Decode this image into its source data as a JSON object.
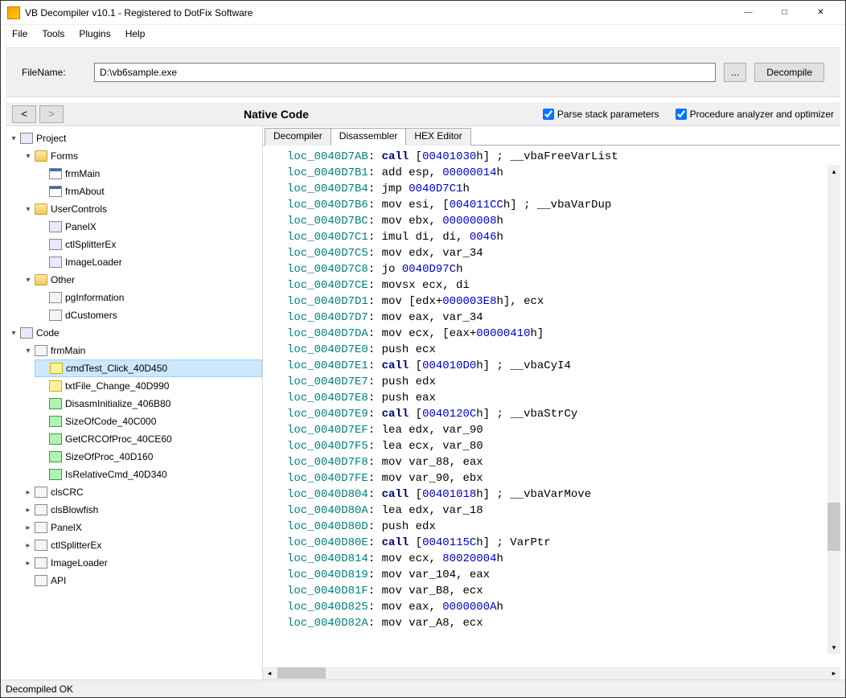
{
  "window": {
    "title": "VB Decompiler v10.1 - Registered to DotFix Software"
  },
  "menu": {
    "file": "File",
    "tools": "Tools",
    "plugins": "Plugins",
    "help": "Help"
  },
  "filebar": {
    "label": "FileName:",
    "value": "D:\\vb6sample.exe",
    "browse": "...",
    "decompile": "Decompile"
  },
  "navrow": {
    "back": "<",
    "fwd": ">",
    "native": "Native Code",
    "chk_parse": "Parse stack parameters",
    "chk_opt": "Procedure analyzer and optimizer"
  },
  "tree": {
    "project": "Project",
    "forms": "Forms",
    "frmMain": "frmMain",
    "frmAbout": "frmAbout",
    "usercontrols": "UserControls",
    "panelx": "PanelX",
    "ctlsplitter": "ctlSplitterEx",
    "imageloader": "ImageLoader",
    "other": "Other",
    "pginfo": "pgInformation",
    "dcustomers": "dCustomers",
    "code": "Code",
    "code_frmMain": "frmMain",
    "cmdtest": "cmdTest_Click_40D450",
    "txtfile": "txtFile_Change_40D990",
    "disasminit": "DisasmInitialize_406B80",
    "sizeofcode": "SizeOfCode_40C000",
    "getcrc": "GetCRCOfProc_40CE60",
    "sizeofproc": "SizeOfProc_40D160",
    "isrelative": "IsRelativeCmd_40D340",
    "clscrc": "clsCRC",
    "clsblowfish": "clsBlowfish",
    "panelx2": "PanelX",
    "ctlsplitter2": "ctlSplitterEx",
    "imageloader2": "ImageLoader",
    "api": "API"
  },
  "tabs": {
    "decompiler": "Decompiler",
    "disassembler": "Disassembler",
    "hex": "HEX Editor"
  },
  "code_lines": [
    {
      "loc": "loc_0040D7AB",
      "tokens": [
        {
          "t": "kw",
          "v": "call"
        },
        {
          "t": "sp",
          "v": " ["
        },
        {
          "t": "addr",
          "v": "00401030"
        },
        {
          "t": "op",
          "v": "h] ; __vbaFreeVarList"
        }
      ]
    },
    {
      "loc": "loc_0040D7B1",
      "tokens": [
        {
          "t": "op",
          "v": "add esp, "
        },
        {
          "t": "num",
          "v": "00000014"
        },
        {
          "t": "op",
          "v": "h"
        }
      ]
    },
    {
      "loc": "loc_0040D7B4",
      "tokens": [
        {
          "t": "op",
          "v": "jmp "
        },
        {
          "t": "addr",
          "v": "0040D7C1"
        },
        {
          "t": "op",
          "v": "h"
        }
      ]
    },
    {
      "loc": "loc_0040D7B6",
      "tokens": [
        {
          "t": "op",
          "v": "mov esi, ["
        },
        {
          "t": "addr",
          "v": "004011CC"
        },
        {
          "t": "op",
          "v": "h] ; __vbaVarDup"
        }
      ]
    },
    {
      "loc": "loc_0040D7BC",
      "tokens": [
        {
          "t": "op",
          "v": "mov ebx, "
        },
        {
          "t": "num",
          "v": "00000008"
        },
        {
          "t": "op",
          "v": "h"
        }
      ]
    },
    {
      "loc": "loc_0040D7C1",
      "tokens": [
        {
          "t": "op",
          "v": "imul di, di, "
        },
        {
          "t": "num",
          "v": "0046"
        },
        {
          "t": "op",
          "v": "h"
        }
      ]
    },
    {
      "loc": "loc_0040D7C5",
      "tokens": [
        {
          "t": "op",
          "v": "mov edx, var_34"
        }
      ]
    },
    {
      "loc": "loc_0040D7C8",
      "tokens": [
        {
          "t": "op",
          "v": "jo "
        },
        {
          "t": "addr",
          "v": "0040D97C"
        },
        {
          "t": "op",
          "v": "h"
        }
      ]
    },
    {
      "loc": "loc_0040D7CE",
      "tokens": [
        {
          "t": "op",
          "v": "movsx ecx, di"
        }
      ]
    },
    {
      "loc": "loc_0040D7D1",
      "tokens": [
        {
          "t": "op",
          "v": "mov [edx+"
        },
        {
          "t": "num",
          "v": "000003E8"
        },
        {
          "t": "op",
          "v": "h], ecx"
        }
      ]
    },
    {
      "loc": "loc_0040D7D7",
      "tokens": [
        {
          "t": "op",
          "v": "mov eax, var_34"
        }
      ]
    },
    {
      "loc": "loc_0040D7DA",
      "tokens": [
        {
          "t": "op",
          "v": "mov ecx, [eax+"
        },
        {
          "t": "num",
          "v": "00000410"
        },
        {
          "t": "op",
          "v": "h]"
        }
      ]
    },
    {
      "loc": "loc_0040D7E0",
      "tokens": [
        {
          "t": "op",
          "v": "push ecx"
        }
      ]
    },
    {
      "loc": "loc_0040D7E1",
      "tokens": [
        {
          "t": "kw",
          "v": "call"
        },
        {
          "t": "sp",
          "v": " ["
        },
        {
          "t": "addr",
          "v": "004010D0"
        },
        {
          "t": "op",
          "v": "h] ; __vbaCyI4"
        }
      ]
    },
    {
      "loc": "loc_0040D7E7",
      "tokens": [
        {
          "t": "op",
          "v": "push edx"
        }
      ]
    },
    {
      "loc": "loc_0040D7E8",
      "tokens": [
        {
          "t": "op",
          "v": "push eax"
        }
      ]
    },
    {
      "loc": "loc_0040D7E9",
      "tokens": [
        {
          "t": "kw",
          "v": "call"
        },
        {
          "t": "sp",
          "v": " ["
        },
        {
          "t": "addr",
          "v": "0040120C"
        },
        {
          "t": "op",
          "v": "h] ; __vbaStrCy"
        }
      ]
    },
    {
      "loc": "loc_0040D7EF",
      "tokens": [
        {
          "t": "op",
          "v": "lea edx, var_90"
        }
      ]
    },
    {
      "loc": "loc_0040D7F5",
      "tokens": [
        {
          "t": "op",
          "v": "lea ecx, var_80"
        }
      ]
    },
    {
      "loc": "loc_0040D7F8",
      "tokens": [
        {
          "t": "op",
          "v": "mov var_88, eax"
        }
      ]
    },
    {
      "loc": "loc_0040D7FE",
      "tokens": [
        {
          "t": "op",
          "v": "mov var_90, ebx"
        }
      ]
    },
    {
      "loc": "loc_0040D804",
      "tokens": [
        {
          "t": "kw",
          "v": "call"
        },
        {
          "t": "sp",
          "v": " ["
        },
        {
          "t": "addr",
          "v": "00401018"
        },
        {
          "t": "op",
          "v": "h] ; __vbaVarMove"
        }
      ]
    },
    {
      "loc": "loc_0040D80A",
      "tokens": [
        {
          "t": "op",
          "v": "lea edx, var_18"
        }
      ]
    },
    {
      "loc": "loc_0040D80D",
      "tokens": [
        {
          "t": "op",
          "v": "push edx"
        }
      ]
    },
    {
      "loc": "loc_0040D80E",
      "tokens": [
        {
          "t": "kw",
          "v": "call"
        },
        {
          "t": "sp",
          "v": " ["
        },
        {
          "t": "addr",
          "v": "0040115C"
        },
        {
          "t": "op",
          "v": "h] ; VarPtr"
        }
      ]
    },
    {
      "loc": "loc_0040D814",
      "tokens": [
        {
          "t": "op",
          "v": "mov ecx, "
        },
        {
          "t": "num",
          "v": "80020004"
        },
        {
          "t": "op",
          "v": "h"
        }
      ]
    },
    {
      "loc": "loc_0040D819",
      "tokens": [
        {
          "t": "op",
          "v": "mov var_104, eax"
        }
      ]
    },
    {
      "loc": "loc_0040D81F",
      "tokens": [
        {
          "t": "op",
          "v": "mov var_B8, ecx"
        }
      ]
    },
    {
      "loc": "loc_0040D825",
      "tokens": [
        {
          "t": "op",
          "v": "mov eax, "
        },
        {
          "t": "num",
          "v": "0000000A"
        },
        {
          "t": "op",
          "v": "h"
        }
      ]
    },
    {
      "loc": "loc_0040D82A",
      "tokens": [
        {
          "t": "op",
          "v": "mov var_A8, ecx"
        }
      ]
    }
  ],
  "status": "Decompiled OK"
}
